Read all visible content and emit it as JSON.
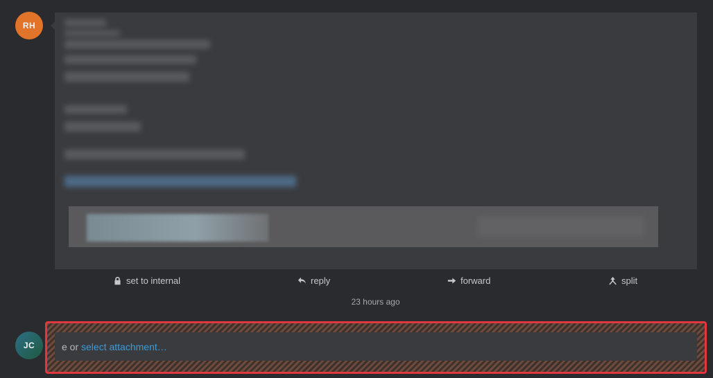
{
  "avatars": {
    "author_initials": "RH",
    "author_color": "#e2742a",
    "current_user_initials": "JC"
  },
  "actions": {
    "internal_label": "set to internal",
    "reply_label": "reply",
    "forward_label": "forward",
    "split_label": "split"
  },
  "article_meta": {
    "timestamp": "23 hours ago"
  },
  "composer": {
    "hint_prefix": "e or ",
    "attach_link_label": "select attachment…",
    "highlight_color": "#e0383e",
    "link_color": "#3d9ad8"
  },
  "icons": {
    "internal": "lock-icon",
    "reply": "reply-arrow-icon",
    "forward": "forward-arrow-icon",
    "split": "split-icon"
  }
}
